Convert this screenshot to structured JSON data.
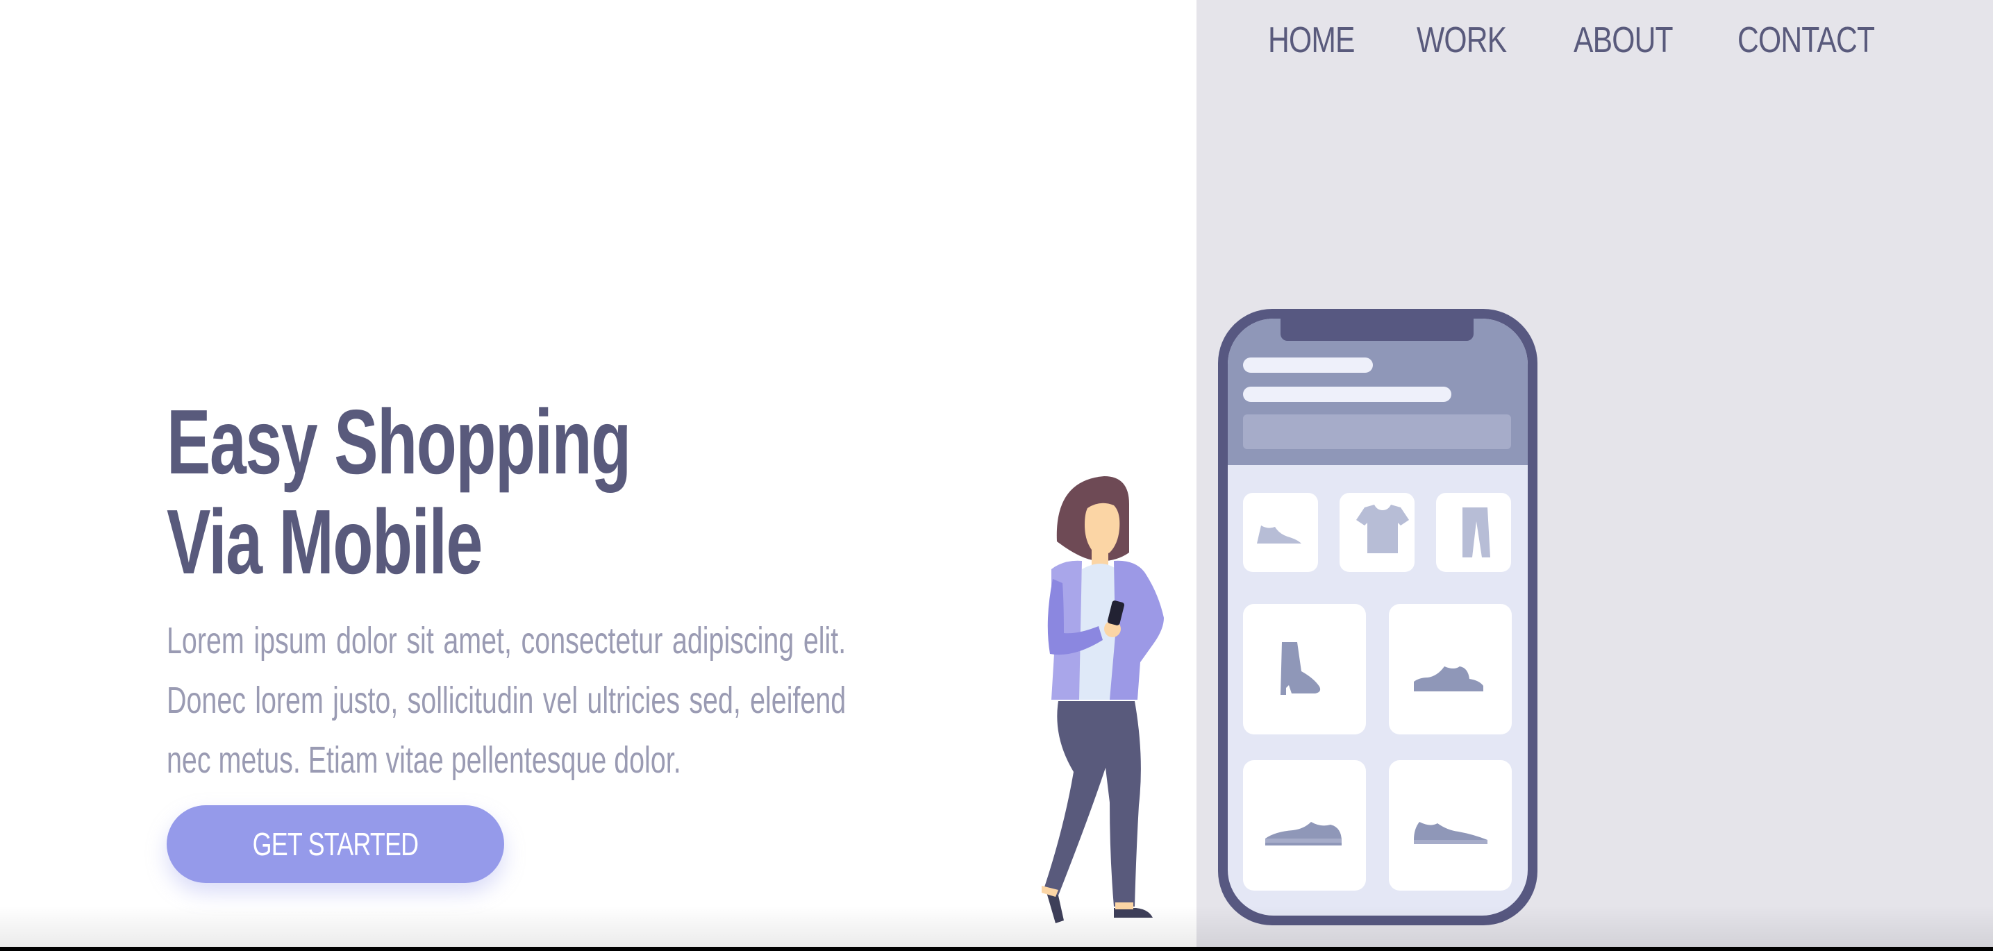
{
  "nav": {
    "items": [
      "HOME",
      "WORK",
      "ABOUT",
      "CONTACT"
    ]
  },
  "hero": {
    "title_line1": "Easy Shopping",
    "title_line2": "Via Mobile",
    "body": "Lorem ipsum dolor sit amet, consectetur adipiscing elit. Donec lorem justo, sollicitudin vel ultricies sed, eleifend nec metus. Etiam vitae pellentesque dolor.",
    "cta_label": "GET STARTED"
  },
  "colors": {
    "primary_text": "#595a7c",
    "muted_text": "#9a9bb3",
    "accent": "#959aea",
    "panel_bg": "#e5e4ea",
    "phone_frame": "#575881"
  },
  "illustration": {
    "phone_product_icons": [
      "shoe-icon",
      "tshirt-icon",
      "pants-icon",
      "boot-icon",
      "sneaker-icon",
      "sneaker-icon",
      "sneaker-icon"
    ],
    "person": "woman-holding-phone"
  }
}
